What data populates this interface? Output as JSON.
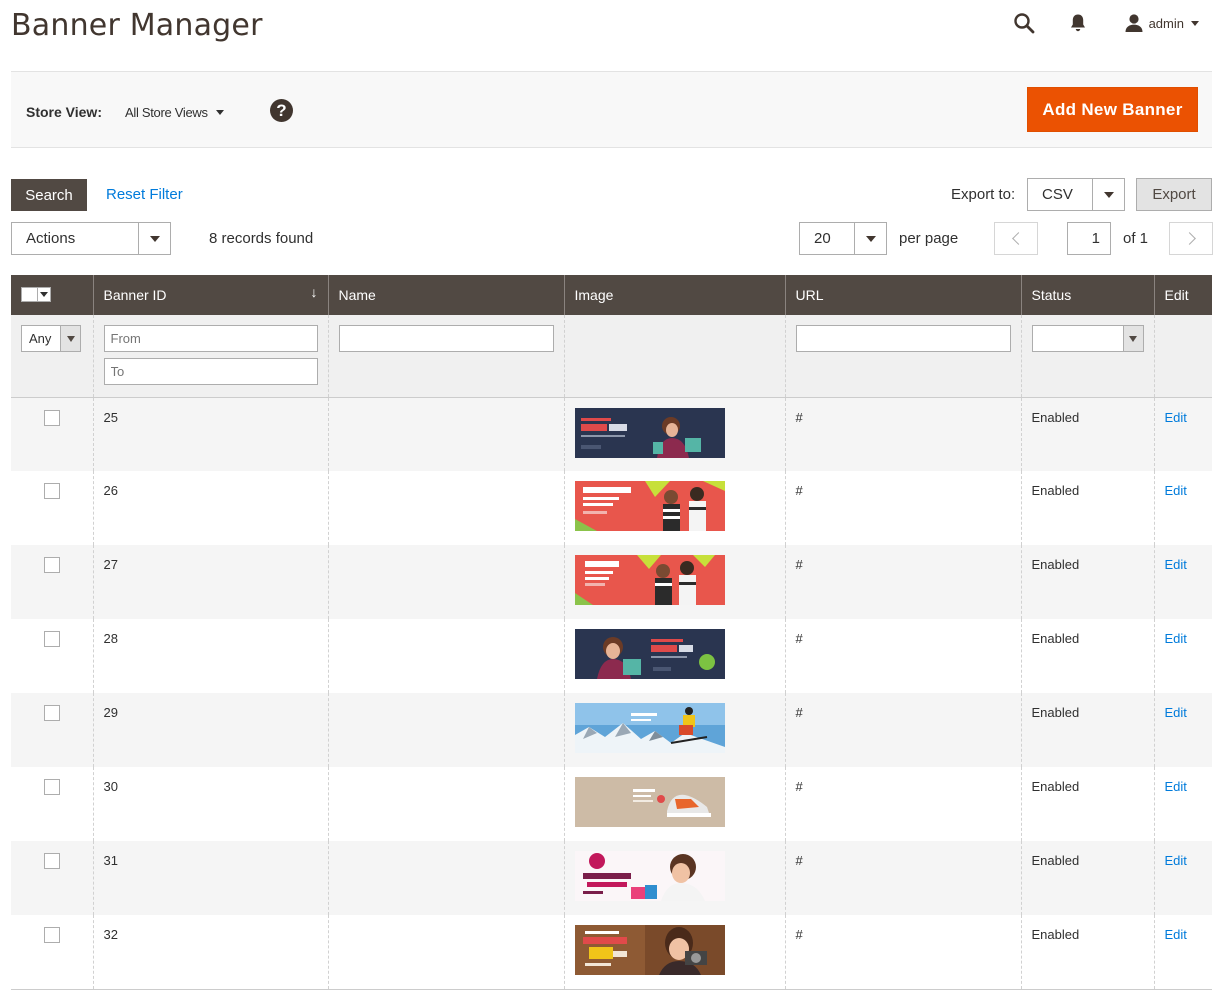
{
  "header": {
    "title": "Banner Manager",
    "user": "admin"
  },
  "store_bar": {
    "label": "Store View:",
    "selected": "All Store Views",
    "help": "?",
    "add_button": "Add New Banner"
  },
  "toolbar": {
    "search": "Search",
    "reset_filter": "Reset Filter",
    "export_label": "Export to:",
    "export_format": "CSV",
    "export_button": "Export",
    "actions": "Actions",
    "records_found": "8 records found",
    "per_page_value": "20",
    "per_page_label": "per page",
    "page": "1",
    "page_of": "of 1"
  },
  "grid": {
    "columns": [
      "Banner ID",
      "Name",
      "Image",
      "URL",
      "Status",
      "Edit"
    ],
    "filters": {
      "mass": "Any",
      "id_from": "From",
      "id_to": "To"
    },
    "rows": [
      {
        "id": "25",
        "name": "",
        "url": "#",
        "status": "Enabled",
        "edit": "Edit",
        "image": "woman-shopping-25-off"
      },
      {
        "id": "26",
        "name": "",
        "url": "#",
        "status": "Enabled",
        "edit": "Edit",
        "image": "shops-boutiques-red"
      },
      {
        "id": "27",
        "name": "",
        "url": "#",
        "status": "Enabled",
        "edit": "Edit",
        "image": "shops-boutiques-red-2"
      },
      {
        "id": "28",
        "name": "",
        "url": "#",
        "status": "Enabled",
        "edit": "Edit",
        "image": "woman-shopping-25-off-2"
      },
      {
        "id": "29",
        "name": "",
        "url": "#",
        "status": "Enabled",
        "edit": "Edit",
        "image": "skier-mountains"
      },
      {
        "id": "30",
        "name": "",
        "url": "#",
        "status": "Enabled",
        "edit": "Edit",
        "image": "sneaker-beige"
      },
      {
        "id": "31",
        "name": "",
        "url": "#",
        "status": "Enabled",
        "edit": "Edit",
        "image": "daily-deals-woman"
      },
      {
        "id": "32",
        "name": "",
        "url": "#",
        "status": "Enabled",
        "edit": "Edit",
        "image": "winter-offer-camera"
      }
    ]
  },
  "colors": {
    "accent": "#eb5202",
    "header_bg": "#514943",
    "link": "#007bdb"
  }
}
